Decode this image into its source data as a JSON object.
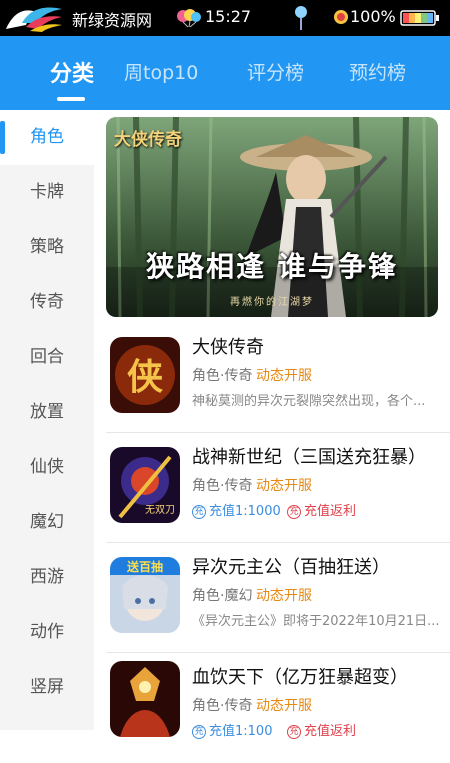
{
  "status_bar": {
    "app_name": "新绿资源网",
    "time": "15:27",
    "battery_percent": "100%",
    "battery_level": 1.0
  },
  "top_tabs": [
    {
      "label": "分类",
      "active": true
    },
    {
      "label": "周top10",
      "active": false
    },
    {
      "label": "评分榜",
      "active": false
    },
    {
      "label": "预约榜",
      "active": false
    }
  ],
  "sidebar": {
    "items": [
      {
        "label": "角色",
        "active": true
      },
      {
        "label": "卡牌"
      },
      {
        "label": "策略"
      },
      {
        "label": "传奇"
      },
      {
        "label": "回合"
      },
      {
        "label": "放置"
      },
      {
        "label": "仙侠"
      },
      {
        "label": "魔幻"
      },
      {
        "label": "西游"
      },
      {
        "label": "动作"
      },
      {
        "label": "竖屏"
      }
    ]
  },
  "banner": {
    "logo_text": "大侠传奇",
    "slogan": "狭路相逢 谁与争锋",
    "subtitle": "再燃你的江湖梦"
  },
  "games": [
    {
      "title": "大侠传奇",
      "categories": "角色·传奇",
      "status": "动态开服",
      "description": "神秘莫测的异次元裂隙突然出现，各个...",
      "icon_text": "侠"
    },
    {
      "title": "战神新世纪（三国送充狂暴）",
      "categories": "角色·传奇",
      "status": "动态开服",
      "perk1": "充值1:1000",
      "perk1_icon": "充",
      "perk2": "充值返利",
      "perk2_icon": "充",
      "icon_text": "无双刀"
    },
    {
      "title": "异次元主公（百抽狂送）",
      "categories": "角色·魔幻",
      "status": "动态开服",
      "description": "《异次元主公》即将于2022年10月21日...",
      "icon_text": "送百抽"
    },
    {
      "title": "血饮天下（亿万狂暴超变）",
      "categories": "角色·传奇",
      "status": "动态开服",
      "perk1": "充值1:100",
      "perk1_icon": "充",
      "perk2": "充值返利",
      "perk2_icon": "充",
      "icon_text": ""
    }
  ],
  "colors": {
    "primary": "#2196f3",
    "status_orange": "#e58a17",
    "perk_blue": "#3a8de0",
    "perk_red": "#e0414b"
  }
}
